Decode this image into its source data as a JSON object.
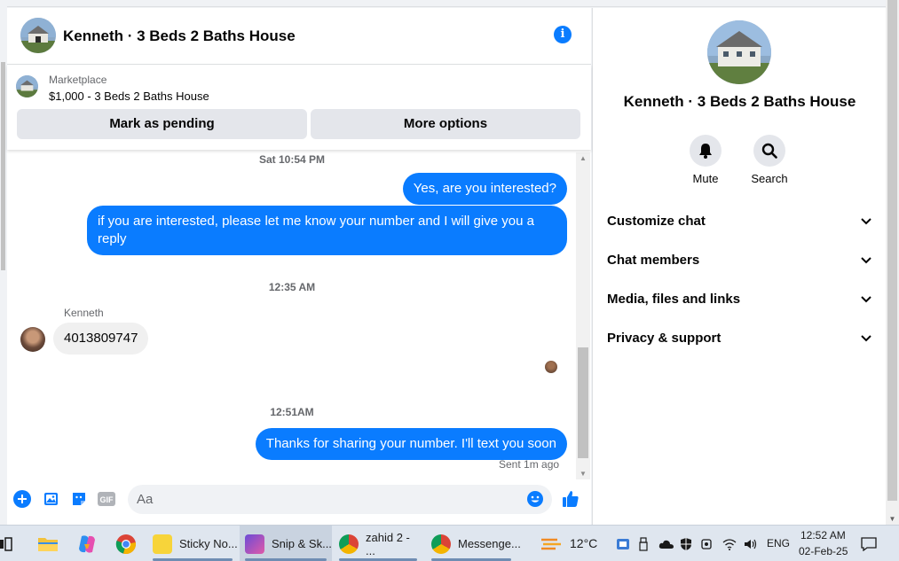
{
  "chat": {
    "title": "Kenneth · 3 Beds 2 Baths House",
    "marketplace": {
      "label": "Marketplace",
      "listing": "$1,000 - 3 Beds 2 Baths House",
      "pending_button": "Mark as pending",
      "more_button": "More options"
    },
    "messages": {
      "partial_timestamp": "Sat 10:54 PM",
      "out1": "Yes, are you interested?",
      "out2": "if you are interested, please let me know your number and I will give you a reply",
      "ts2": "12:35 AM",
      "sender_name": "Kenneth",
      "in1": "4013809747",
      "ts3": "12:51AM",
      "out3": "Thanks for sharing your number. I'll text you soon",
      "status": "Sent 1m ago"
    },
    "composer": {
      "placeholder": "Aa",
      "icons": [
        "plus-icon",
        "image-icon",
        "sticker-icon",
        "gif-icon",
        "emoji-icon",
        "like-icon"
      ],
      "gif_label": "GIF"
    }
  },
  "right_panel": {
    "title": "Kenneth · 3 Beds 2 Baths House",
    "actions": [
      {
        "label": "Mute",
        "icon": "bell-icon"
      },
      {
        "label": "Search",
        "icon": "search-icon"
      }
    ],
    "sections": [
      "Customize chat",
      "Chat members",
      "Media, files and links",
      "Privacy & support"
    ]
  },
  "taskbar": {
    "apps": [
      {
        "label": "Sticky No...",
        "icon": "sticky-notes-icon"
      },
      {
        "label": "Snip & Sk...",
        "icon": "snip-sketch-icon"
      },
      {
        "label": "zahid 2 - ...",
        "icon": "chrome-icon"
      },
      {
        "label": "Messenge...",
        "icon": "chrome-icon"
      }
    ],
    "weather": "12°C",
    "language": "ENG",
    "time": "12:52 AM",
    "date": "02-Feb-25"
  },
  "colors": {
    "accent": "#0a7cff",
    "bubble_in": "#f0f0f0",
    "button_bg": "#e4e6eb",
    "taskbar_bg": "#dfe6ef"
  }
}
